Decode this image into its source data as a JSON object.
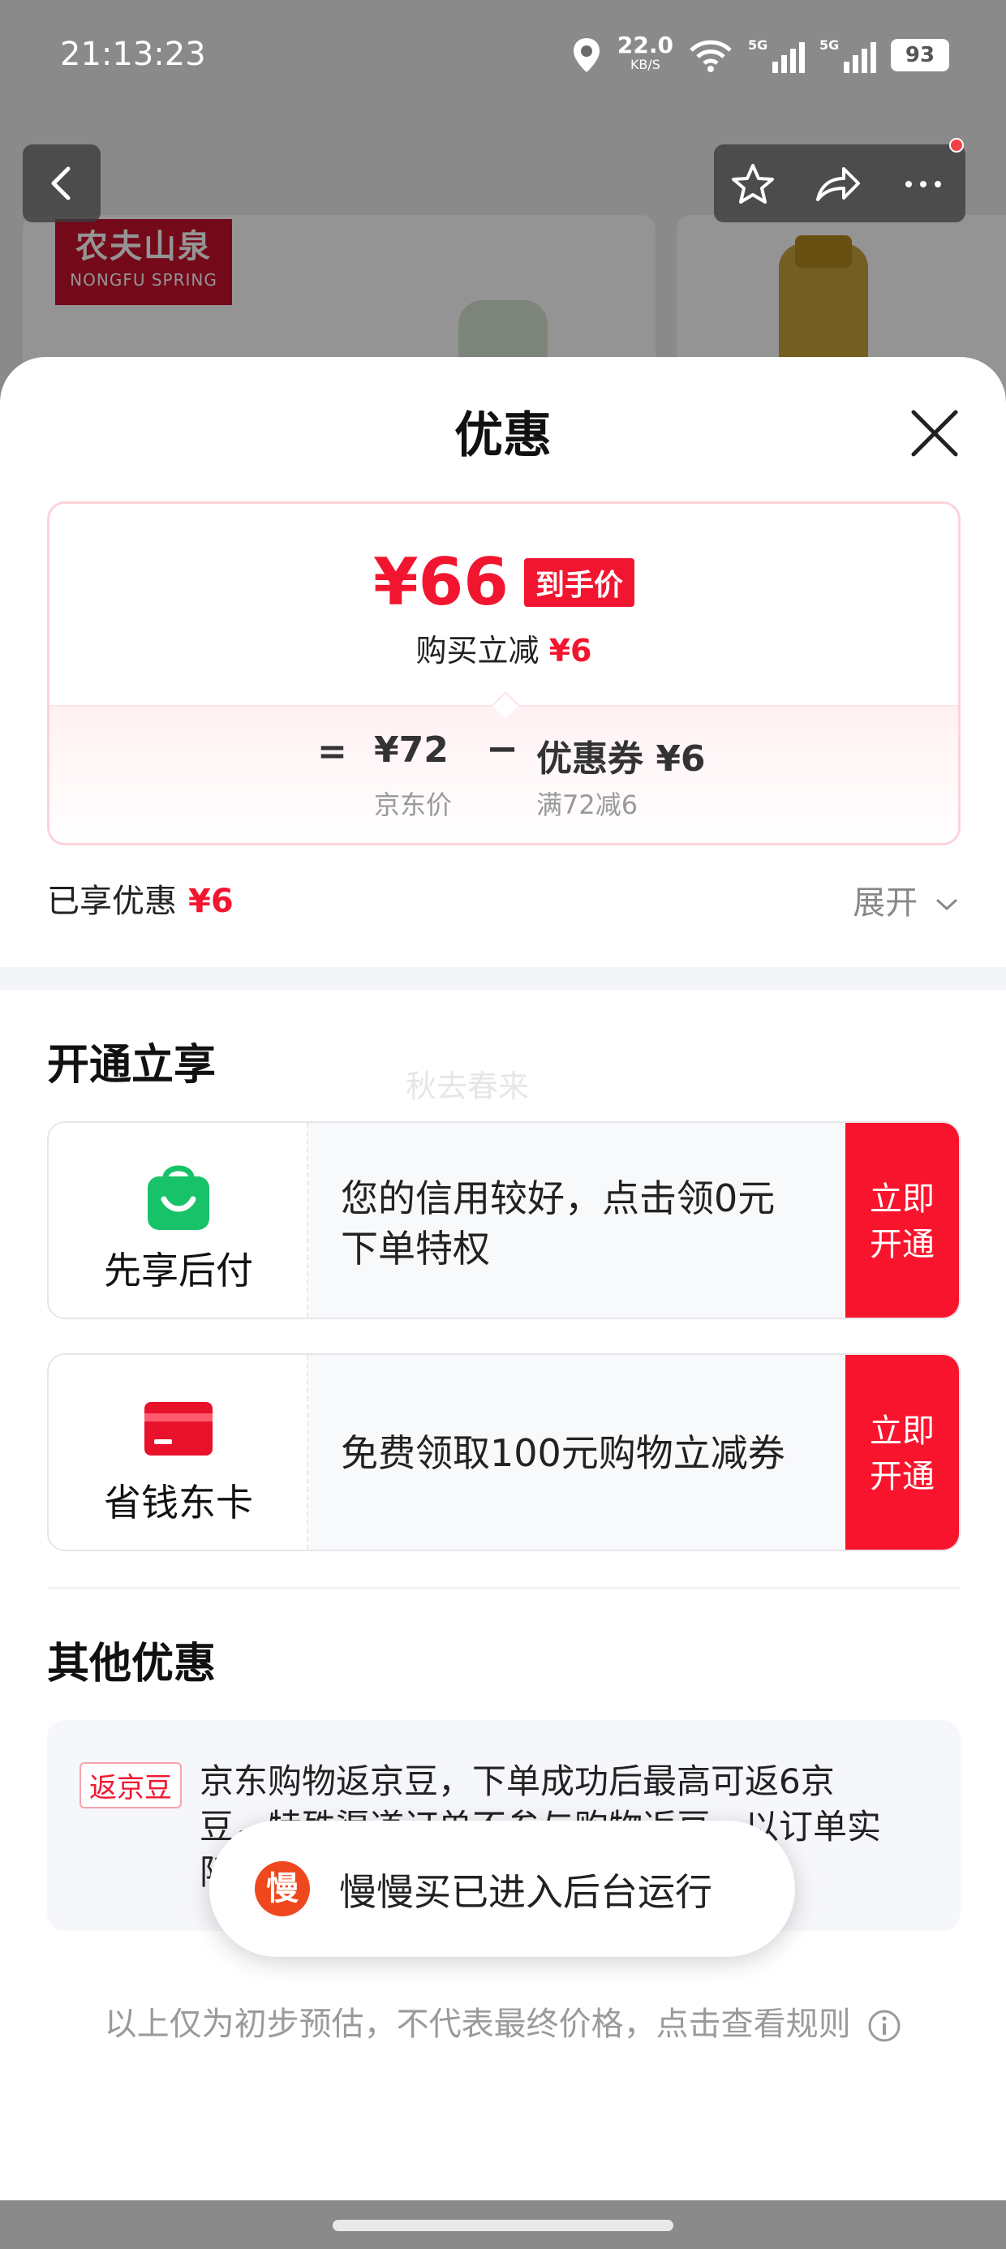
{
  "status_bar": {
    "time": "21:13:23",
    "net_speed": "22.0",
    "net_unit": "KB/S",
    "sig1_label": "5G",
    "sig2_label": "5G",
    "battery": "93"
  },
  "background": {
    "brand_cn": "农夫山泉",
    "brand_en": "NONGFU SPRING"
  },
  "sheet": {
    "title": "优惠",
    "price": {
      "final_price": "¥66",
      "final_tag": "到手价",
      "instant_off_label": "购买立减",
      "instant_off_value": "¥6",
      "equals": "=",
      "jd_price": "¥72",
      "jd_price_label": "京东价",
      "minus": "−",
      "coupon_price": "优惠券 ¥6",
      "coupon_condition": "满72减6"
    },
    "enjoyed_label": "已享优惠",
    "enjoyed_value": "¥6",
    "expand_label": "展开",
    "open_section_title": "开通立享",
    "watermark": "秋去春来",
    "offers": [
      {
        "name": "先享后付",
        "desc": "您的信用较好，点击领0元下单特权",
        "button": "立即开通"
      },
      {
        "name": "省钱东卡",
        "desc": "免费领取100元购物立减券",
        "button": "立即开通"
      }
    ],
    "other_section_title": "其他优惠",
    "other": {
      "badge": "返京豆",
      "text_line1": "京东购物返京豆，下单成功后最高可返6京",
      "text_line2": "豆，特殊渠道订单不参与购物返豆，以订单实",
      "text_line3": "际"
    },
    "toast": {
      "icon_char": "慢",
      "text": "慢慢买已进入后台运行"
    },
    "disclaimer": "以上仅为初步预估，不代表最终价格，点击查看规则"
  },
  "colors": {
    "accent_red": "#f2152f",
    "button_red": "#f8142c",
    "pay_green": "#18c268",
    "card_red": "#e8122b",
    "toast_orange": "#f0481e"
  }
}
